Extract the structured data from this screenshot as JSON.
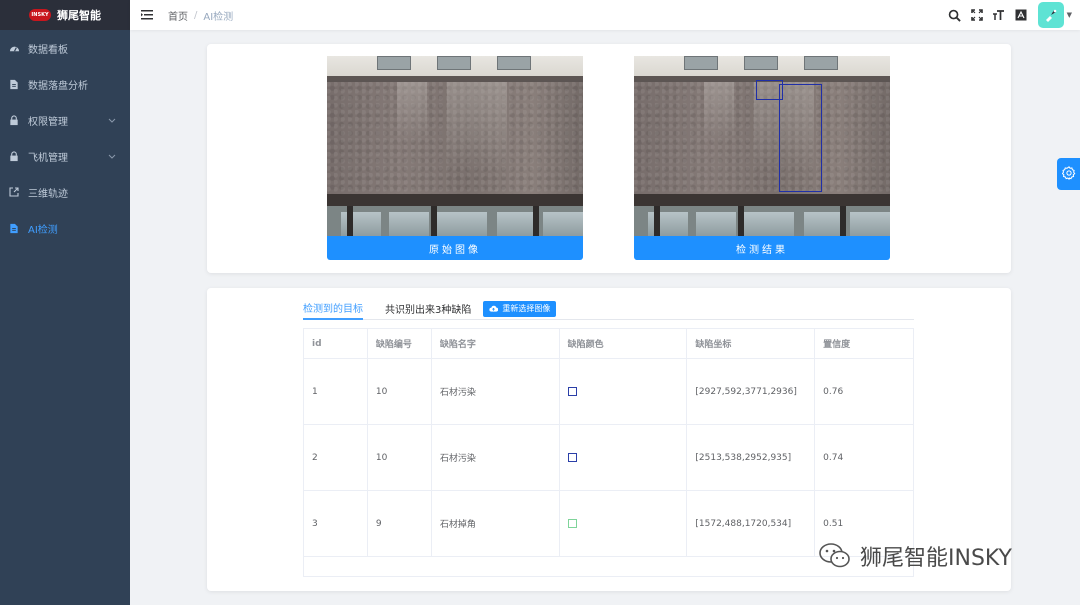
{
  "app": {
    "logo_badge": "INSKY",
    "logo_text": "狮尾智能"
  },
  "sidebar": {
    "items": [
      {
        "label": "数据看板",
        "icon": "dashboard-icon"
      },
      {
        "label": "数据落盘分析",
        "icon": "document-icon"
      },
      {
        "label": "权限管理",
        "icon": "lock-icon",
        "has_children": true
      },
      {
        "label": "飞机管理",
        "icon": "lock-icon",
        "has_children": true
      },
      {
        "label": "三维轨迹",
        "icon": "external-link-icon"
      },
      {
        "label": "AI检测",
        "icon": "document-icon",
        "active": true
      }
    ]
  },
  "header": {
    "breadcrumb": [
      "首页",
      "AI检测"
    ],
    "icons": [
      "search-icon",
      "fullscreen-icon",
      "font-size-icon",
      "translate-icon"
    ]
  },
  "images": {
    "original_label": "原始图像",
    "result_label": "检测结果"
  },
  "tabs": {
    "detected": "检测到的目标",
    "summary": "共识别出来3种缺陷",
    "reselect": "重新选择图像"
  },
  "table": {
    "headers": [
      "id",
      "缺陷编号",
      "缺陷名字",
      "缺陷颜色",
      "缺陷坐标",
      "置信度"
    ],
    "rows": [
      {
        "id": "1",
        "code": "10",
        "name": "石材污染",
        "color": "#2b3fa8",
        "coords": "[2927,592,3771,2936]",
        "confidence": "0.76"
      },
      {
        "id": "2",
        "code": "10",
        "name": "石材污染",
        "color": "#2b3fa8",
        "coords": "[2513,538,2952,935]",
        "confidence": "0.74"
      },
      {
        "id": "3",
        "code": "9",
        "name": "石材掉角",
        "color": "#7fd49a",
        "coords": "[1572,488,1720,534]",
        "confidence": "0.51"
      }
    ]
  },
  "watermark": {
    "text": "狮尾智能INSKY"
  },
  "colors": {
    "sidebar_bg": "#304156",
    "accent": "#1e90ff",
    "active_menu": "#409eff"
  }
}
